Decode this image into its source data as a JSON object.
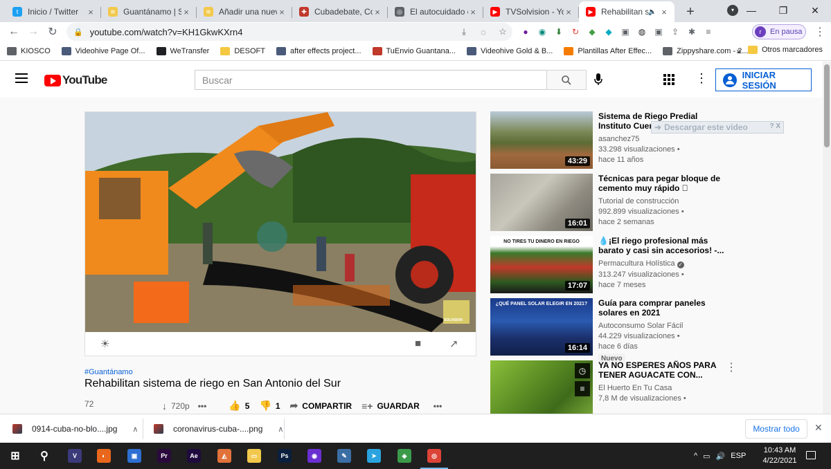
{
  "browser": {
    "tabs": [
      {
        "title": "Inicio / Twitter",
        "icon": "twitter-icon",
        "color": "#1da1f2",
        "glyph": "t"
      },
      {
        "title": "Guantánamo | So",
        "icon": "rss-icon",
        "color": "#f2c94c",
        "glyph": "≋"
      },
      {
        "title": "Añadir una nueva",
        "icon": "rss-icon",
        "color": "#f2c94c",
        "glyph": "≋"
      },
      {
        "title": "Cubadebate, Con",
        "icon": "cubadebate-icon",
        "color": "#c0392b",
        "glyph": "✚"
      },
      {
        "title": "El autocuidado c",
        "icon": "globe-icon",
        "color": "#5f6368",
        "glyph": "◎"
      },
      {
        "title": "TVSolvision - You",
        "icon": "youtube-icon",
        "color": "#ff0000",
        "glyph": "▶"
      },
      {
        "title": "Rehabilitan s",
        "icon": "youtube-icon",
        "color": "#ff0000",
        "glyph": "▶",
        "active": true,
        "audio": "🔈"
      }
    ],
    "new_tab": "+",
    "window_controls": {
      "minimize": "—",
      "maximize": "❐",
      "close": "✕"
    },
    "nav": {
      "back": "←",
      "forward": "→",
      "reload": "↻"
    },
    "url": "youtube.com/watch?v=KH1GkwKXrn4",
    "omnibox_icons": [
      "install-icon",
      "eye-off-icon",
      "star-icon"
    ],
    "omnibox_glyphs": [
      "⤓",
      "◌",
      "☆"
    ],
    "extensions": [
      {
        "name": "extension-1-icon",
        "glyph": "●",
        "color": "#6a1b9a"
      },
      {
        "name": "extension-2-icon",
        "glyph": "◉",
        "color": "#00897b"
      },
      {
        "name": "download-arrow-icon",
        "glyph": "⬇",
        "color": "#2e7d32"
      },
      {
        "name": "extension-4-icon",
        "glyph": "↻",
        "color": "#e53935"
      },
      {
        "name": "extension-5-icon",
        "glyph": "◆",
        "color": "#43a047"
      },
      {
        "name": "extension-6-icon",
        "glyph": "◆",
        "color": "#00acc1"
      },
      {
        "name": "extension-7-icon",
        "glyph": "▣",
        "color": "#5f6368"
      },
      {
        "name": "extension-8-icon",
        "glyph": "◍",
        "color": "#202124"
      },
      {
        "name": "extension-9-icon",
        "glyph": "▣",
        "color": "#5f6368"
      },
      {
        "name": "extension-10-icon",
        "glyph": "⇪",
        "color": "#5f6368"
      },
      {
        "name": "puzzle-icon",
        "glyph": "✱",
        "color": "#5f6368"
      },
      {
        "name": "reading-list-icon",
        "glyph": "≡",
        "color": "#5f6368"
      }
    ],
    "profile": {
      "initial": "r",
      "label": "En pausa"
    },
    "menu": "⋮",
    "bookmarks": [
      {
        "label": "KIOSCO",
        "color": "#5f6368"
      },
      {
        "label": "Videohive Page Of...",
        "color": "#4a5a7a"
      },
      {
        "label": "WeTransfer",
        "color": "#202124"
      },
      {
        "label": "DESOFT",
        "color": "#f5c842"
      },
      {
        "label": "after effects project...",
        "color": "#4a5a7a"
      },
      {
        "label": "TuEnvio Guantana...",
        "color": "#c0392b"
      },
      {
        "label": "Videohive Gold & B...",
        "color": "#4a5a7a"
      },
      {
        "label": "Plantillas After Effec...",
        "color": "#f57c00"
      },
      {
        "label": "Zippyshare.com - 2...",
        "color": "#5f6368"
      }
    ],
    "bookmarks_more": "»",
    "other_bookmarks": "Otros marcadores"
  },
  "youtube": {
    "logo_text": "YouTube",
    "search_placeholder": "Buscar",
    "signin_label": "INICIAR SESIÓN",
    "video": {
      "hashtag": "#Guantánamo",
      "title": "Rehabilitan sistema de riego en San Antonio del Sur",
      "views": "72",
      "quality": "720p",
      "likes": "5",
      "dislikes": "1",
      "share_label": "COMPARTIR",
      "save_label": "GUARDAR",
      "watermark": "SOLVISION"
    },
    "download_bar_label": "Descargar este video",
    "download_bar_help": "?",
    "download_bar_close": "X",
    "recommendations": [
      {
        "title": "Sistema de Riego Predial Instituto Cuencas",
        "channel": "asanchez75",
        "views": "33.298 visualizaciones •",
        "age": "hace 11 años",
        "duration": "43:29",
        "theme": "field"
      },
      {
        "title": "Técnicas para pegar bloque de cemento muy rápido 🏻",
        "channel": "Tutorial de construcción",
        "views": "992.899 visualizaciones •",
        "age": "hace 2 semanas",
        "duration": "16:01",
        "theme": "blocks"
      },
      {
        "title": "💧¡El riego profesional más barato y casi sin accesorios! -...",
        "channel": "Permacultura Holística",
        "verified": true,
        "views": "313.247 visualizaciones •",
        "age": "hace 7 meses",
        "duration": "17:07",
        "theme": "drip",
        "thumb_text": "NO TIRES TU DINERO EN RIEGO"
      },
      {
        "title": "Guía para comprar paneles solares en 2021",
        "channel": "Autoconsumo Solar Fácil",
        "views": "44.229 visualizaciones •",
        "age": "hace 6 días",
        "duration": "16:14",
        "badge": "Nuevo",
        "theme": "solar",
        "thumb_text": "¿QUÉ PANEL SOLAR ELEGIR EN 2021?"
      },
      {
        "title": "YA NO ESPERES AÑOS PARA TENER AGUACATE CON...",
        "channel": "El Huerto En Tu Casa",
        "views": "7,8 M de visualizaciones •",
        "age": "",
        "duration": "",
        "theme": "avocado"
      }
    ]
  },
  "downloads": {
    "items": [
      {
        "filename": "0914-cuba-no-blo....jpg"
      },
      {
        "filename": "coronavirus-cuba-....png"
      }
    ],
    "show_all": "Mostrar todo",
    "close": "✕"
  },
  "taskbar": {
    "apps": [
      {
        "name": "start-icon",
        "glyph": "⊞",
        "color": "transparent"
      },
      {
        "name": "search-icon",
        "glyph": "⚲",
        "color": "transparent"
      },
      {
        "name": "vegas-icon",
        "glyph": "V",
        "color": "#3b3a7a"
      },
      {
        "name": "firefox-icon",
        "glyph": "◐",
        "color": "#e8671c"
      },
      {
        "name": "save-icon",
        "glyph": "▣",
        "color": "#2e6fd1"
      },
      {
        "name": "premiere-icon",
        "glyph": "Pr",
        "color": "#2a0a3d"
      },
      {
        "name": "after-effects-icon",
        "glyph": "Ae",
        "color": "#1f0a3d"
      },
      {
        "name": "mega-icon",
        "glyph": "◭",
        "color": "#e0723a"
      },
      {
        "name": "file-explorer-icon",
        "glyph": "▭",
        "color": "#f2c94c"
      },
      {
        "name": "photoshop-icon",
        "glyph": "Ps",
        "color": "#0a1f3d"
      },
      {
        "name": "media-player-icon",
        "glyph": "◉",
        "color": "#6a2fd1"
      },
      {
        "name": "paint-icon",
        "glyph": "✎",
        "color": "#3a6ea5"
      },
      {
        "name": "telegram-icon",
        "glyph": "➤",
        "color": "#2aa3df"
      },
      {
        "name": "network-map-icon",
        "glyph": "◈",
        "color": "#3a9a4a"
      },
      {
        "name": "chrome-icon",
        "glyph": "◎",
        "color": "#db4437",
        "active": true
      }
    ],
    "tray": {
      "chevron": "^",
      "network": "▭",
      "volume": "🔊",
      "lang": "ESP"
    },
    "time": "10:43 AM",
    "date": "4/22/2021"
  }
}
